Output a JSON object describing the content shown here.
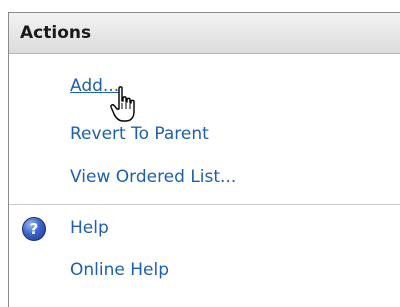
{
  "panel": {
    "title": "Actions"
  },
  "actions": [
    {
      "label": "Add..."
    },
    {
      "label": "Revert To Parent"
    },
    {
      "label": "View Ordered List..."
    }
  ],
  "help": {
    "icon": "help-icon",
    "help_label": "Help",
    "online_help_label": "Online Help"
  },
  "cursor": {
    "icon": "hand-pointer-icon"
  }
}
